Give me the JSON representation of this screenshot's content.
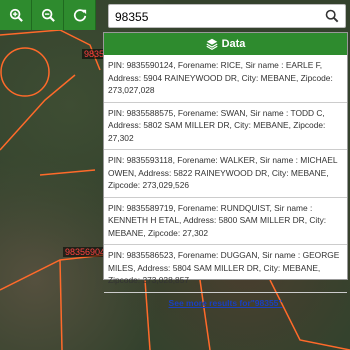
{
  "toolbar": {
    "buttons": [
      {
        "icon": "zoom-in-icon"
      },
      {
        "icon": "zoom-out-icon"
      },
      {
        "icon": "refresh-icon"
      }
    ]
  },
  "search": {
    "value": "98355",
    "icon": "search-icon"
  },
  "map": {
    "labels": [
      "98355",
      "983569042"
    ]
  },
  "panel": {
    "title": "Data",
    "title_icon": "layers-icon",
    "results": [
      "PIN: 9835590124, Forename: RICE, Sir name : EARLE F, Address: 5904 RAINEYWOOD DR, City: MEBANE, Zipcode: 273,027,028",
      "PIN: 9835588575, Forename: SWAN, Sir name : TODD C, Address: 5802 SAM MILLER DR, City: MEBANE, Zipcode: 27,302",
      "PIN: 9835593118, Forename: WALKER, Sir name : MICHAEL OWEN, Address: 5822 RAINEYWOOD DR, City: MEBANE, Zipcode: 273,029,526",
      "PIN: 9835589719, Forename: RUNDQUIST, Sir name : KENNETH H ETAL, Address: 5800 SAM MILLER DR, City: MEBANE, Zipcode: 27,302",
      "PIN: 9835586523, Forename: DUGGAN, Sir name : GEORGE MILES, Address: 5804 SAM MILLER DR, City: MEBANE, Zipcode: 273,028,857"
    ],
    "see_more": "See more results for\"98355\""
  },
  "colors": {
    "accent": "#2e8b2e",
    "parcel_line": "#ff6a2a",
    "link": "#1a3fbf"
  }
}
